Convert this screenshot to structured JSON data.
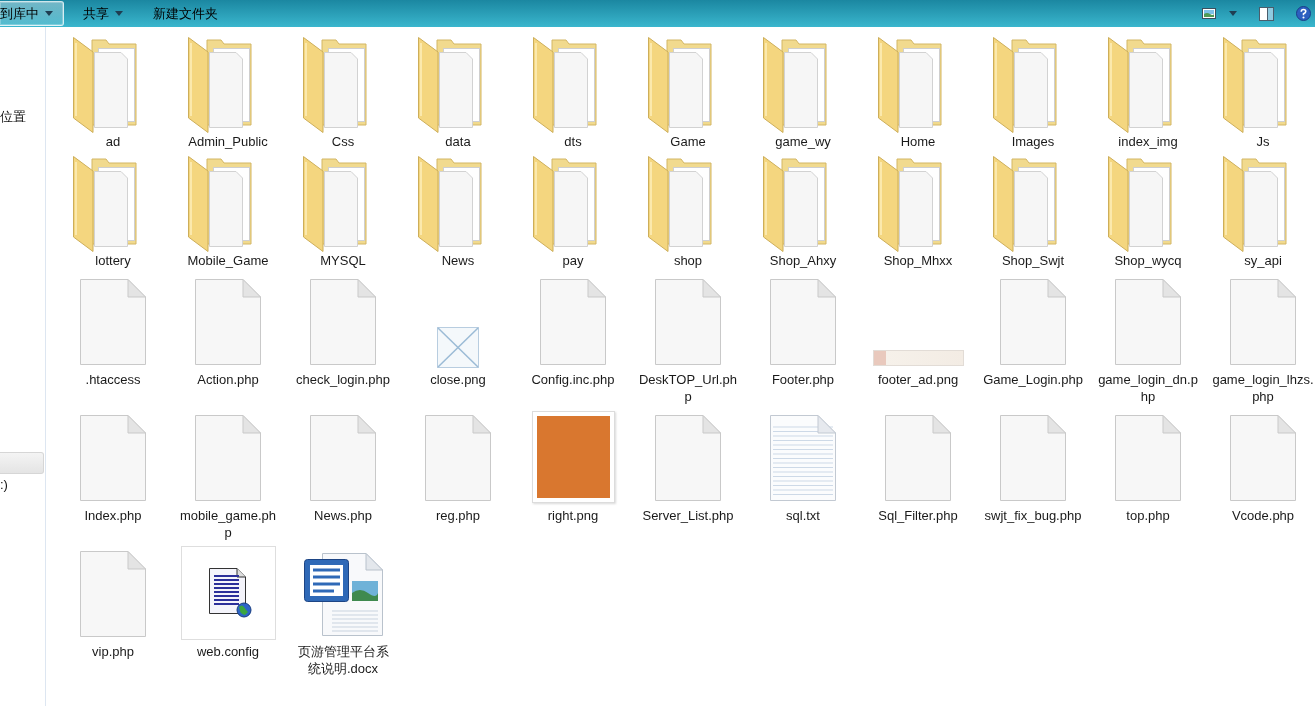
{
  "toolbar": {
    "buttons": [
      {
        "label": "到库中",
        "dropdown": true,
        "highlighted": true
      },
      {
        "label": "共享",
        "dropdown": true,
        "highlighted": false
      },
      {
        "label": "新建文件夹",
        "dropdown": false,
        "highlighted": false
      }
    ]
  },
  "sidebar": {
    "items": [
      {
        "label": "位置",
        "selected": false
      },
      {
        "selected": true
      },
      {
        "label": ":)",
        "selected": false
      }
    ]
  },
  "files": [
    {
      "name": "ad",
      "kind": "folder"
    },
    {
      "name": "Admin_Public",
      "kind": "folder"
    },
    {
      "name": "Css",
      "kind": "folder"
    },
    {
      "name": "data",
      "kind": "folder"
    },
    {
      "name": "dts",
      "kind": "folder"
    },
    {
      "name": "Game",
      "kind": "folder"
    },
    {
      "name": "game_wy",
      "kind": "folder"
    },
    {
      "name": "Home",
      "kind": "folder"
    },
    {
      "name": "Images",
      "kind": "folder"
    },
    {
      "name": "index_img",
      "kind": "folder"
    },
    {
      "name": "Js",
      "kind": "folder"
    },
    {
      "name": "lottery",
      "kind": "folder"
    },
    {
      "name": "Mobile_Game",
      "kind": "folder"
    },
    {
      "name": "MYSQL",
      "kind": "folder"
    },
    {
      "name": "News",
      "kind": "folder"
    },
    {
      "name": "pay",
      "kind": "folder"
    },
    {
      "name": "shop",
      "kind": "folder"
    },
    {
      "name": "Shop_Ahxy",
      "kind": "folder"
    },
    {
      "name": "Shop_Mhxx",
      "kind": "folder"
    },
    {
      "name": "Shop_Swjt",
      "kind": "folder"
    },
    {
      "name": "Shop_wycq",
      "kind": "folder"
    },
    {
      "name": "sy_api",
      "kind": "folder"
    },
    {
      "name": ".htaccess",
      "kind": "file"
    },
    {
      "name": "Action.php",
      "kind": "file"
    },
    {
      "name": "check_login.php",
      "kind": "file"
    },
    {
      "name": "close.png",
      "kind": "cross"
    },
    {
      "name": "Config.inc.php",
      "kind": "file"
    },
    {
      "name": "DeskTOP_Url.php",
      "kind": "file"
    },
    {
      "name": "Footer.php",
      "kind": "file"
    },
    {
      "name": "footer_ad.png",
      "kind": "banner"
    },
    {
      "name": "Game_Login.php",
      "kind": "file"
    },
    {
      "name": "game_login_dn.php",
      "kind": "file"
    },
    {
      "name": "game_login_lhzs.php",
      "kind": "file"
    },
    {
      "name": "Index.php",
      "kind": "file"
    },
    {
      "name": "mobile_game.php",
      "kind": "file"
    },
    {
      "name": "News.php",
      "kind": "file"
    },
    {
      "name": "reg.php",
      "kind": "file"
    },
    {
      "name": "right.png",
      "kind": "photo"
    },
    {
      "name": "Server_List.php",
      "kind": "file"
    },
    {
      "name": "sql.txt",
      "kind": "text"
    },
    {
      "name": "Sql_Filter.php",
      "kind": "file"
    },
    {
      "name": "swjt_fix_bug.php",
      "kind": "file"
    },
    {
      "name": "top.php",
      "kind": "file"
    },
    {
      "name": "Vcode.php",
      "kind": "file"
    },
    {
      "name": "vip.php",
      "kind": "file"
    },
    {
      "name": "web.config",
      "kind": "config"
    },
    {
      "name": "页游管理平台系统说明.docx",
      "kind": "document"
    }
  ]
}
